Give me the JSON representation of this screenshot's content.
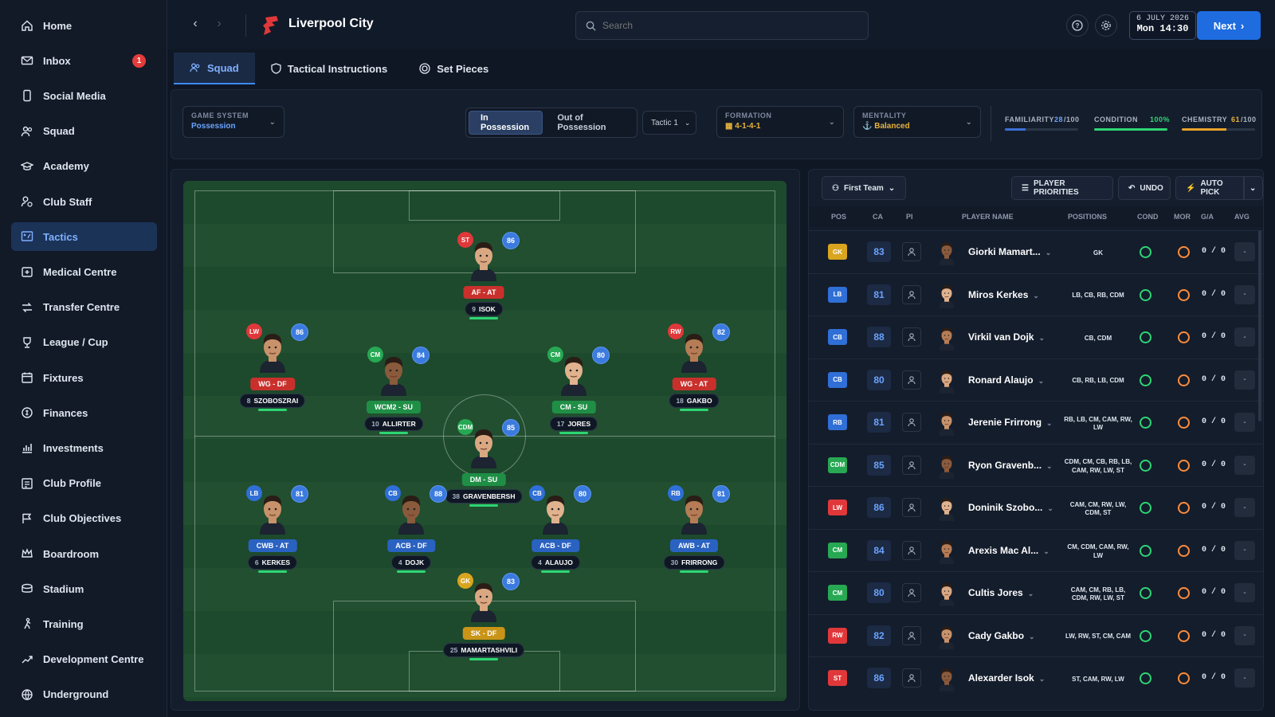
{
  "sidebar": {
    "items": [
      {
        "label": "Home",
        "icon": "home-icon"
      },
      {
        "label": "Inbox",
        "icon": "mail-icon",
        "badge": "1"
      },
      {
        "label": "Social Media",
        "icon": "phone-icon"
      },
      {
        "label": "Squad",
        "icon": "people-icon"
      },
      {
        "label": "Academy",
        "icon": "graduation-icon"
      },
      {
        "label": "Club Staff",
        "icon": "staff-icon"
      },
      {
        "label": "Tactics",
        "icon": "tactics-board-icon",
        "active": true
      },
      {
        "label": "Medical Centre",
        "icon": "medical-icon"
      },
      {
        "label": "Transfer Centre",
        "icon": "transfer-icon"
      },
      {
        "label": "League / Cup",
        "icon": "trophy-icon"
      },
      {
        "label": "Fixtures",
        "icon": "calendar-icon"
      },
      {
        "label": "Finances",
        "icon": "coins-icon"
      },
      {
        "label": "Investments",
        "icon": "chart-icon"
      },
      {
        "label": "Club Profile",
        "icon": "profile-card-icon"
      },
      {
        "label": "Club Objectives",
        "icon": "flag-icon"
      },
      {
        "label": "Boardroom",
        "icon": "crown-icon"
      },
      {
        "label": "Stadium",
        "icon": "stadium-icon"
      },
      {
        "label": "Training",
        "icon": "training-icon"
      },
      {
        "label": "Development Centre",
        "icon": "trend-up-icon"
      },
      {
        "label": "Underground",
        "icon": "globe-icon"
      }
    ]
  },
  "header": {
    "club_name": "Liverpool City",
    "search_placeholder": "Search",
    "date": "6 JULY 2026",
    "time": "Mon 14:30",
    "next_label": "Next"
  },
  "tabs": [
    {
      "label": "Squad",
      "active": true
    },
    {
      "label": "Tactical Instructions"
    },
    {
      "label": "Set Pieces"
    }
  ],
  "controls": {
    "game_system_label": "GAME SYSTEM",
    "game_system_value": "Possession",
    "in_possession": "In Possession",
    "out_of_possession": "Out of Possession",
    "tactic": "Tactic 1",
    "formation_label": "FORMATION",
    "formation_value": "4-1-4-1",
    "mentality_label": "MENTALITY",
    "mentality_value": "Balanced",
    "familiarity_label": "FAMILIARITY",
    "familiarity_value": "28",
    "familiarity_max": "/100",
    "familiarity_pct": 28,
    "condition_label": "CONDITION",
    "condition_value": "100%",
    "condition_pct": 100,
    "chemistry_label": "CHEMISTRY",
    "chemistry_value": "61",
    "chemistry_max": "/100",
    "chemistry_pct": 61
  },
  "pitch_players": [
    {
      "pos": "ST",
      "rating": "86",
      "role": "AF - AT",
      "number": "9",
      "name": "ISOK",
      "pos_color": "#e0383a",
      "role_color": "#c9302c"
    },
    {
      "pos": "LW",
      "rating": "86",
      "role": "WG - DF",
      "number": "8",
      "name": "SZOBOSZRAI",
      "pos_color": "#e0383a",
      "role_color": "#c9302c"
    },
    {
      "pos": "CM",
      "rating": "84",
      "role": "WCM2 - SU",
      "number": "10",
      "name": "ALLIRTER",
      "pos_color": "#27a853",
      "role_color": "#1f8f46"
    },
    {
      "pos": "CM",
      "rating": "80",
      "role": "CM - SU",
      "number": "17",
      "name": "JORES",
      "pos_color": "#27a853",
      "role_color": "#1f8f46"
    },
    {
      "pos": "RW",
      "rating": "82",
      "role": "WG - AT",
      "number": "18",
      "name": "GAKBO",
      "pos_color": "#e0383a",
      "role_color": "#c9302c"
    },
    {
      "pos": "CDM",
      "rating": "85",
      "role": "DM - SU",
      "number": "38",
      "name": "GRAVENBERSH",
      "pos_color": "#27a853",
      "role_color": "#1f8f46"
    },
    {
      "pos": "LB",
      "rating": "81",
      "role": "CWB - AT",
      "number": "6",
      "name": "KERKES",
      "pos_color": "#2f6fd6",
      "role_color": "#2a62c2"
    },
    {
      "pos": "CB",
      "rating": "88",
      "role": "ACB - DF",
      "number": "4",
      "name": "DOJK",
      "pos_color": "#2f6fd6",
      "role_color": "#2a62c2"
    },
    {
      "pos": "CB",
      "rating": "80",
      "role": "ACB - DF",
      "number": "4",
      "name": "ALAUJO",
      "pos_color": "#2f6fd6",
      "role_color": "#2a62c2"
    },
    {
      "pos": "RB",
      "rating": "81",
      "role": "AWB - AT",
      "number": "30",
      "name": "FRIRRONG",
      "pos_color": "#2f6fd6",
      "role_color": "#2a62c2"
    },
    {
      "pos": "GK",
      "rating": "83",
      "role": "SK - DF",
      "number": "25",
      "name": "MAMARTASHVILI",
      "pos_color": "#d9a51e",
      "role_color": "#c99417"
    }
  ],
  "list": {
    "team_select": "First Team",
    "priorities_label": "PLAYER PRIORITIES",
    "undo_label": "UNDO",
    "autopick_label": "AUTO PICK",
    "columns": [
      "POS",
      "CA",
      "PI",
      "PLAYER NAME",
      "POSITIONS",
      "COND",
      "MOR",
      "G/A",
      "AVG"
    ],
    "rows": [
      {
        "pos": "GK",
        "ca": "83",
        "name": "Giorki Mamart...",
        "positions": "GK",
        "ga": "0 / 0",
        "avg": "-",
        "color": "#d9a51e"
      },
      {
        "pos": "LB",
        "ca": "81",
        "name": "Miros Kerkes",
        "positions": "LB, CB, RB, CDM",
        "ga": "0 / 0",
        "avg": "-",
        "color": "#2f6fd6"
      },
      {
        "pos": "CB",
        "ca": "88",
        "name": "Virkil van Dojk",
        "positions": "CB, CDM",
        "ga": "0 / 0",
        "avg": "-",
        "color": "#2f6fd6"
      },
      {
        "pos": "CB",
        "ca": "80",
        "name": "Ronard Alaujo",
        "positions": "CB, RB, LB, CDM",
        "ga": "0 / 0",
        "avg": "-",
        "color": "#2f6fd6"
      },
      {
        "pos": "RB",
        "ca": "81",
        "name": "Jerenie Frirrong",
        "positions": "RB, LB, CM, CAM, RW, LW",
        "ga": "0 / 0",
        "avg": "-",
        "color": "#2f6fd6"
      },
      {
        "pos": "CDM",
        "ca": "85",
        "name": "Ryon Gravenb...",
        "positions": "CDM, CM, CB, RB, LB, CAM, RW, LW, ST",
        "ga": "0 / 0",
        "avg": "-",
        "color": "#27a853"
      },
      {
        "pos": "LW",
        "ca": "86",
        "name": "Doninik Szobo...",
        "positions": "CAM, CM, RW, LW, CDM, ST",
        "ga": "0 / 0",
        "avg": "-",
        "color": "#e0383a"
      },
      {
        "pos": "CM",
        "ca": "84",
        "name": "Arexis Mac Al...",
        "positions": "CM, CDM, CAM, RW, LW",
        "ga": "0 / 0",
        "avg": "-",
        "color": "#27a853"
      },
      {
        "pos": "CM",
        "ca": "80",
        "name": "Cultis Jores",
        "positions": "CAM, CM, RB, LB, CDM, RW, LW, ST",
        "ga": "0 / 0",
        "avg": "-",
        "color": "#27a853"
      },
      {
        "pos": "RW",
        "ca": "82",
        "name": "Cady Gakbo",
        "positions": "LW, RW, ST, CM, CAM",
        "ga": "0 / 0",
        "avg": "-",
        "color": "#e0383a"
      },
      {
        "pos": "ST",
        "ca": "86",
        "name": "Alexarder Isok",
        "positions": "ST, CAM, RW, LW",
        "ga": "0 / 0",
        "avg": "-",
        "color": "#e0383a"
      }
    ]
  }
}
